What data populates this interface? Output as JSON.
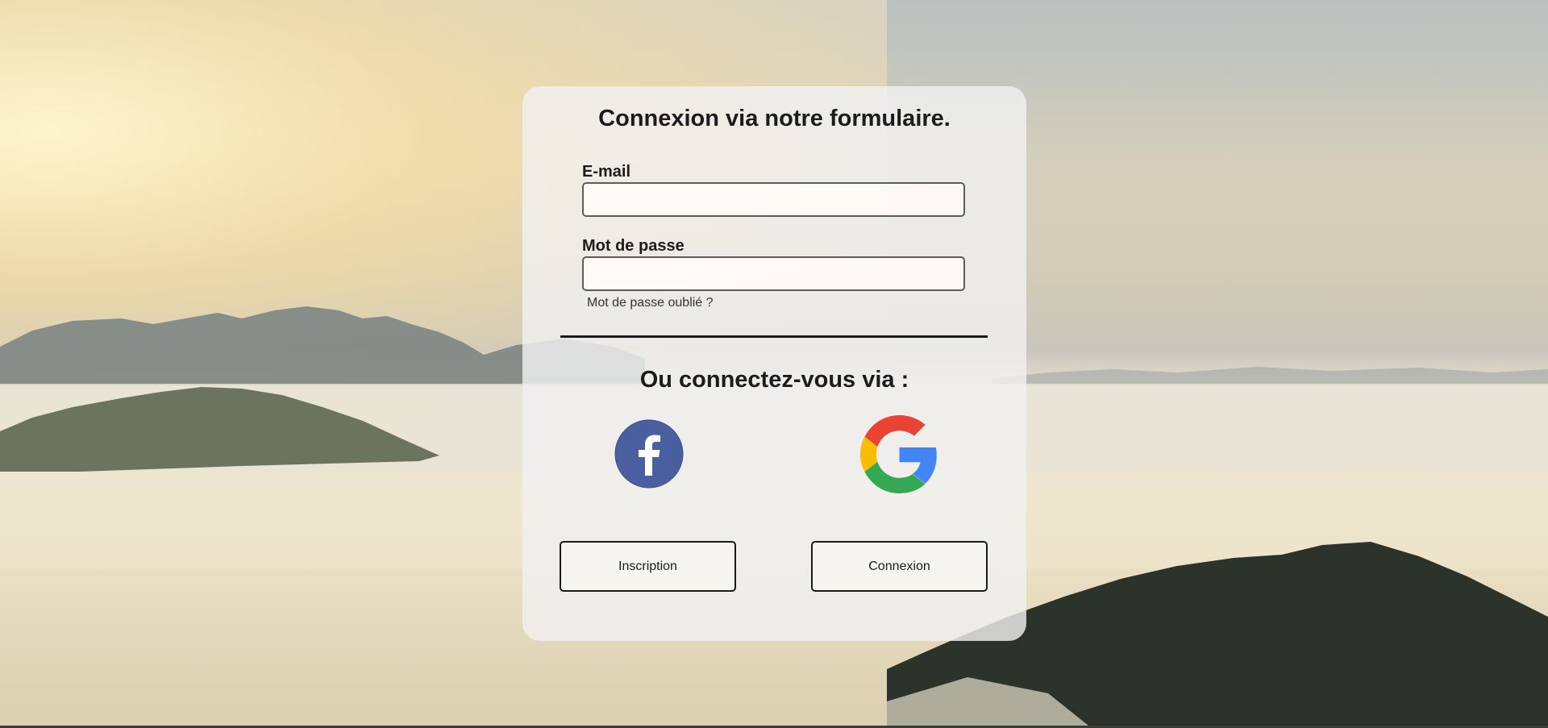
{
  "form": {
    "title": "Connexion via notre formulaire.",
    "email_label": "E-mail",
    "email_value": "",
    "password_label": "Mot de passe",
    "password_value": "",
    "forgot_password": "Mot de passe oublié ?",
    "alt_title": "Ou connectez-vous via :"
  },
  "social": {
    "facebook_icon": "facebook-icon",
    "google_icon": "google-icon",
    "facebook_color": "#4a5fa0",
    "google_colors": [
      "#ea4335",
      "#fbbc05",
      "#34a853",
      "#4285f4"
    ]
  },
  "buttons": {
    "signup_label": "Inscription",
    "login_label": "Connexion"
  }
}
